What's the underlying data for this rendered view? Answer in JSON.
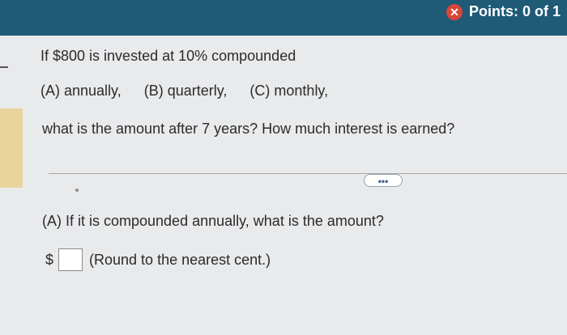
{
  "header": {
    "points_label": "Points: 0 of 1",
    "close_icon": "close-icon"
  },
  "question": {
    "line1": "If $800 is invested at 10% compounded",
    "line2_a": "(A) annually,",
    "line2_b": "(B) quarterly,",
    "line2_c": "(C) monthly,",
    "line3": "what is the amount after 7 years? How much interest is earned?"
  },
  "actions": {
    "more_label": "•••"
  },
  "part_a": {
    "prompt": "(A) If it is compounded annually, what is the amount?",
    "currency": "$",
    "instruction": "(Round to the nearest cent.)"
  },
  "colors": {
    "topbar": "#1f5a76",
    "accent": "#3d5f8f",
    "warning": "#d9453a"
  }
}
